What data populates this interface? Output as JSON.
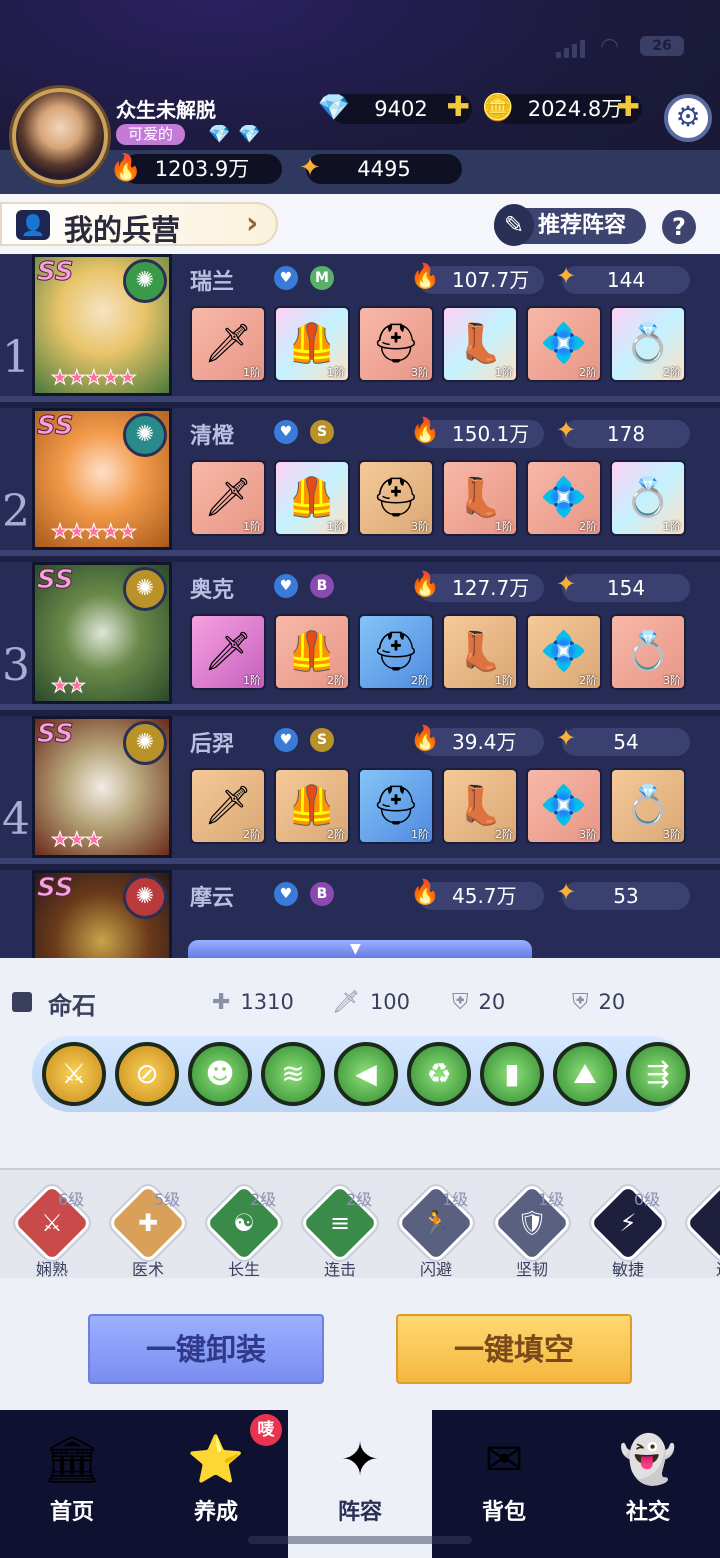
{
  "status": {
    "battery": "26"
  },
  "player": {
    "name": "众生未解脱",
    "title": "可爱的",
    "diamonds": "9402",
    "gold": "2024.8万",
    "power": "1203.9万",
    "stars": "4495"
  },
  "header": {
    "title": "我的兵营",
    "recommend": "推荐阵容",
    "help": "?"
  },
  "heroes": [
    {
      "num": "1",
      "name": "瑞兰",
      "grade": "M",
      "power": "107.7万",
      "level": "144",
      "stars": "★★★★★",
      "gear": [
        {
          "icon": "🗡",
          "g": "1阶",
          "c": "g-r"
        },
        {
          "icon": "🦺",
          "g": "1阶",
          "c": "g-p"
        },
        {
          "icon": "⛑",
          "g": "3阶",
          "c": "g-r"
        },
        {
          "icon": "👢",
          "g": "1阶",
          "c": "g-p"
        },
        {
          "icon": "💠",
          "g": "2阶",
          "c": "g-r"
        },
        {
          "icon": "💍",
          "g": "2阶",
          "c": "g-p"
        }
      ]
    },
    {
      "num": "2",
      "name": "清橙",
      "grade": "S",
      "power": "150.1万",
      "level": "178",
      "stars": "★★★★★",
      "gear": [
        {
          "icon": "🗡",
          "g": "1阶",
          "c": "g-r"
        },
        {
          "icon": "🦺",
          "g": "1阶",
          "c": "g-p"
        },
        {
          "icon": "⛑",
          "g": "3阶",
          "c": "g-o"
        },
        {
          "icon": "👢",
          "g": "1阶",
          "c": "g-r"
        },
        {
          "icon": "💠",
          "g": "2阶",
          "c": "g-r"
        },
        {
          "icon": "💍",
          "g": "1阶",
          "c": "g-p"
        }
      ]
    },
    {
      "num": "3",
      "name": "奥克",
      "grade": "B",
      "power": "127.7万",
      "level": "154",
      "stars": "★★",
      "gear": [
        {
          "icon": "🗡",
          "g": "1阶",
          "c": "g-m"
        },
        {
          "icon": "🦺",
          "g": "2阶",
          "c": "g-r"
        },
        {
          "icon": "⛑",
          "g": "2阶",
          "c": "g-b"
        },
        {
          "icon": "👢",
          "g": "1阶",
          "c": "g-o"
        },
        {
          "icon": "💠",
          "g": "2阶",
          "c": "g-o"
        },
        {
          "icon": "💍",
          "g": "3阶",
          "c": "g-r"
        }
      ]
    },
    {
      "num": "4",
      "name": "后羿",
      "grade": "S",
      "power": "39.4万",
      "level": "54",
      "stars": "★★★",
      "gear": [
        {
          "icon": "🗡",
          "g": "2阶",
          "c": "g-o"
        },
        {
          "icon": "🦺",
          "g": "2阶",
          "c": "g-o"
        },
        {
          "icon": "⛑",
          "g": "1阶",
          "c": "g-b"
        },
        {
          "icon": "👢",
          "g": "2阶",
          "c": "g-o"
        },
        {
          "icon": "💠",
          "g": "3阶",
          "c": "g-r"
        },
        {
          "icon": "💍",
          "g": "3阶",
          "c": "g-o"
        }
      ]
    },
    {
      "num": "",
      "name": "摩云",
      "grade": "B",
      "power": "45.7万",
      "level": "53",
      "stars": "",
      "gear": []
    }
  ],
  "mingshi": {
    "title": "命石",
    "hp": "1310",
    "atk": "100",
    "def": "20",
    "res": "20"
  },
  "skills": [
    {
      "name": "娴熟",
      "level": "6级",
      "color": "#c94a4a",
      "icon": "⚔"
    },
    {
      "name": "医术",
      "level": "5级",
      "color": "#d9a05a",
      "icon": "✚"
    },
    {
      "name": "长生",
      "level": "2级",
      "color": "#3a8a4a",
      "icon": "☯"
    },
    {
      "name": "连击",
      "level": "2级",
      "color": "#3a8a4a",
      "icon": "≡"
    },
    {
      "name": "闪避",
      "level": "1级",
      "color": "#5a6080",
      "icon": "🏃"
    },
    {
      "name": "坚韧",
      "level": "1级",
      "color": "#5a6080",
      "icon": "🛡"
    },
    {
      "name": "敏捷",
      "level": "0级",
      "color": "#1d1f3d",
      "icon": "⚡"
    },
    {
      "name": "进",
      "level": "",
      "color": "#1d1f3d",
      "icon": "•"
    }
  ],
  "buttons": {
    "unequip": "一键卸装",
    "fill": "一键填空"
  },
  "nav": [
    {
      "label": "首页",
      "icon": "🏛"
    },
    {
      "label": "养成",
      "icon": "⭐"
    },
    {
      "label": "阵容",
      "icon": "✦"
    },
    {
      "label": "背包",
      "icon": "✉"
    },
    {
      "label": "社交",
      "icon": "👻"
    }
  ],
  "badge": "唛"
}
